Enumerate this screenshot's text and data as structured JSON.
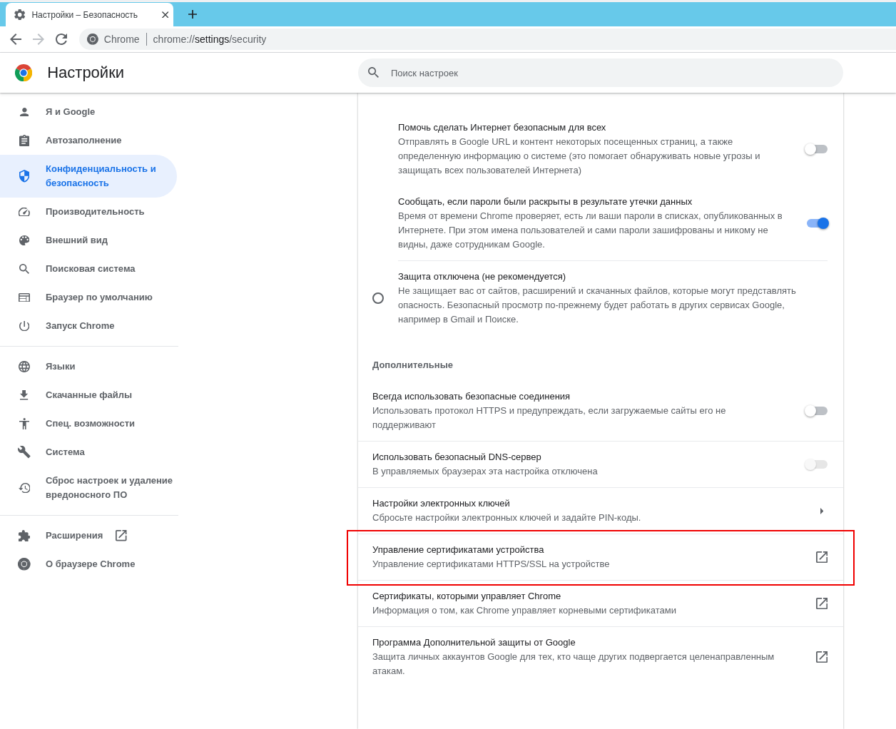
{
  "browser": {
    "tabs": [
      {
        "title": "Настройки – Безопасность",
        "selected": true
      }
    ],
    "nav_buttons": [
      {
        "kind": "back",
        "disabled": false
      },
      {
        "kind": "forward",
        "disabled": true
      },
      {
        "kind": "reload",
        "disabled": false
      }
    ],
    "omnibox": {
      "chip": "Chrome",
      "url": "chrome://**settings**/security"
    }
  },
  "header": {
    "title": "Настройки",
    "search": {
      "placeholder": "Поиск настроек"
    }
  },
  "sidebar": {
    "groups": [
      {
        "items": [
          {
            "label": "Я и Google",
            "selected": false,
            "external": false
          },
          {
            "label": "Автозаполнение",
            "selected": false,
            "external": false
          },
          {
            "label": "Конфиденциальность и безопасность",
            "selected": true,
            "external": false
          },
          {
            "label": "Производительность",
            "selected": false,
            "external": false
          },
          {
            "label": "Внешний вид",
            "selected": false,
            "external": false
          },
          {
            "label": "Поисковая система",
            "selected": false,
            "external": false
          },
          {
            "label": "Браузер по умолчанию",
            "selected": false,
            "external": false
          },
          {
            "label": "Запуск Chrome",
            "selected": false,
            "external": false
          }
        ]
      },
      {
        "items": [
          {
            "label": "Языки",
            "selected": false,
            "external": false
          },
          {
            "label": "Скачанные файлы",
            "selected": false,
            "external": false
          },
          {
            "label": "Спец. возможности",
            "selected": false,
            "external": false
          },
          {
            "label": "Система",
            "selected": false,
            "external": false
          },
          {
            "label": "Сброс настроек и удаление вредоносного ПО",
            "selected": false,
            "external": false
          }
        ]
      },
      {
        "items": [
          {
            "label": "Расширения",
            "selected": false,
            "external": true
          },
          {
            "label": "О браузере Chrome",
            "selected": false,
            "external": false
          }
        ]
      }
    ]
  },
  "content": {
    "suboptions": [
      {
        "title": "Помочь сделать Интернет безопасным для всех",
        "description": "Отправлять в Google URL и контент некоторых посещенных страниц, а также определенную информацию о системе (это помогает обнаруживать новые угрозы и защищать всех пользователей Интернета)",
        "on": false
      },
      {
        "title": "Сообщать, если пароли были раскрыты в результате утечки данных",
        "description": "Время от времени Chrome проверяет, есть ли ваши пароли в списках, опубликованных в Интернете. При этом имена пользователей и сами пароли зашифрованы и никому не видны, даже сотрудникам Google.",
        "on": true
      }
    ],
    "options": [
      {
        "title": "Защита отключена (не рекомендуется)",
        "description": "Не защищает вас от сайтов, расширений и скачанных файлов, которые могут представлять опасность. Безопасный просмотр по-прежнему будет работать в других сервисах Google, например в Gmail и Поиске.",
        "selected": false
      }
    ],
    "advanced": {
      "title": "Дополнительные",
      "rows": [
        {
          "kind": "toggle",
          "title": "Всегда использовать безопасные соединения",
          "description": "Использовать протокол HTTPS и предупреждать, если загружаемые сайты его не поддерживают",
          "on": false,
          "disabled": false,
          "highlighted": false
        },
        {
          "kind": "toggle",
          "title": "Использовать безопасный DNS-сервер",
          "description": "В управляемых браузерах эта настройка отключена",
          "on": false,
          "disabled": true,
          "highlighted": false
        },
        {
          "kind": "submenu",
          "title": "Настройки электронных ключей",
          "description": "Сбросьте настройки электронных ключей и задайте PIN-коды.",
          "highlighted": false
        },
        {
          "kind": "external",
          "title": "Управление сертификатами устройства",
          "description": "Управление сертификатами HTTPS/SSL на устройстве",
          "highlighted": true
        },
        {
          "kind": "external",
          "title": "Сертификаты, которыми управляет Chrome",
          "description": "Информация о том, как Chrome управляет корневыми сертификатами",
          "highlighted": false
        },
        {
          "kind": "external",
          "title": "Программа Дополнительной защиты от Google",
          "description": "Защита личных аккаунтов Google для тех, кто чаще других подвергается целенаправленным атакам.",
          "highlighted": false
        }
      ]
    }
  }
}
